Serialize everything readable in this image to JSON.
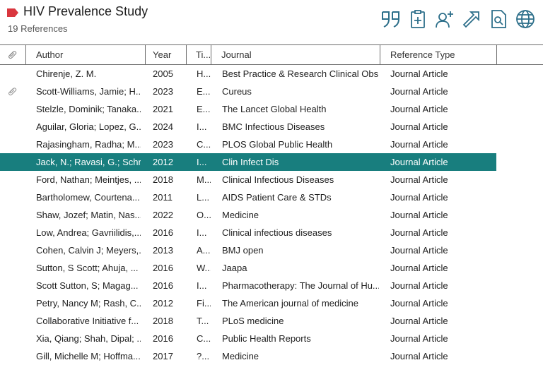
{
  "header": {
    "title": "HIV Prevalence Study",
    "subtitle": "19 References",
    "tag_color": "#d9363e"
  },
  "toolbar": [
    {
      "name": "insert-citation-icon"
    },
    {
      "name": "add-to-clipboard-icon"
    },
    {
      "name": "share-add-user-icon"
    },
    {
      "name": "open-external-icon"
    },
    {
      "name": "find-pdf-icon"
    },
    {
      "name": "online-search-icon"
    }
  ],
  "table": {
    "columns": {
      "attachment": "",
      "author": "Author",
      "year": "Year",
      "title": "Ti...",
      "journal": "Journal",
      "type": "Reference Type"
    },
    "selected_color": "#187e7e",
    "rows": [
      {
        "attachment": false,
        "author": "Chirenje, Z. M.",
        "year": "2005",
        "title": "H...",
        "journal": "Best Practice & Research Clinical Obs...",
        "type": "Journal Article",
        "selected": false
      },
      {
        "attachment": true,
        "author": "Scott-Williams, Jamie; H...",
        "year": "2023",
        "title": "E...",
        "journal": "Cureus",
        "type": "Journal Article",
        "selected": false
      },
      {
        "attachment": false,
        "author": "Stelzle, Dominik; Tanaka...",
        "year": "2021",
        "title": "E...",
        "journal": "The Lancet Global Health",
        "type": "Journal Article",
        "selected": false
      },
      {
        "attachment": false,
        "author": "Aguilar, Gloria; Lopez, G...",
        "year": "2024",
        "title": "I...",
        "journal": "BMC Infectious Diseases",
        "type": "Journal Article",
        "selected": false
      },
      {
        "attachment": false,
        "author": "Rajasingham, Radha; M...",
        "year": "2023",
        "title": "C...",
        "journal": "PLOS Global Public Health",
        "type": "Journal Article",
        "selected": false
      },
      {
        "attachment": false,
        "author": "Jack, N.; Ravasi, G.; Schr...",
        "year": "2012",
        "title": "I...",
        "journal": "Clin Infect Dis",
        "type": "Journal Article",
        "selected": true
      },
      {
        "attachment": false,
        "author": "Ford, Nathan; Meintjes, ...",
        "year": "2018",
        "title": "M...",
        "journal": "Clinical Infectious Diseases",
        "type": "Journal Article",
        "selected": false
      },
      {
        "attachment": false,
        "author": "Bartholomew, Courtena...",
        "year": "2011",
        "title": "L...",
        "journal": "AIDS Patient Care & STDs",
        "type": "Journal Article",
        "selected": false
      },
      {
        "attachment": false,
        "author": "Shaw, Jozef; Matin, Nas...",
        "year": "2022",
        "title": "O...",
        "journal": "Medicine",
        "type": "Journal Article",
        "selected": false
      },
      {
        "attachment": false,
        "author": "Low, Andrea; Gavriilidis,...",
        "year": "2016",
        "title": "I...",
        "journal": "Clinical infectious diseases",
        "type": "Journal Article",
        "selected": false
      },
      {
        "attachment": false,
        "author": "Cohen, Calvin J; Meyers,...",
        "year": "2013",
        "title": "A...",
        "journal": "BMJ open",
        "type": "Journal Article",
        "selected": false
      },
      {
        "attachment": false,
        "author": "Sutton, S Scott; Ahuja, ...",
        "year": "2016",
        "title": "W...",
        "journal": "Jaapa",
        "type": "Journal Article",
        "selected": false
      },
      {
        "attachment": false,
        "author": "Scott Sutton, S; Magag...",
        "year": "2016",
        "title": "I...",
        "journal": "Pharmacotherapy: The Journal of Hu...",
        "type": "Journal Article",
        "selected": false
      },
      {
        "attachment": false,
        "author": "Petry, Nancy M; Rash, C...",
        "year": "2012",
        "title": "Fi...",
        "journal": "The American journal of medicine",
        "type": "Journal Article",
        "selected": false
      },
      {
        "attachment": false,
        "author": "Collaborative Initiative f...",
        "year": "2018",
        "title": "T...",
        "journal": "PLoS medicine",
        "type": "Journal Article",
        "selected": false
      },
      {
        "attachment": false,
        "author": "Xia, Qiang; Shah, Dipal; ...",
        "year": "2016",
        "title": "C...",
        "journal": "Public Health Reports",
        "type": "Journal Article",
        "selected": false
      },
      {
        "attachment": false,
        "author": "Gill, Michelle M; Hoffma...",
        "year": "2017",
        "title": "?...",
        "journal": "Medicine",
        "type": "Journal Article",
        "selected": false
      }
    ]
  }
}
